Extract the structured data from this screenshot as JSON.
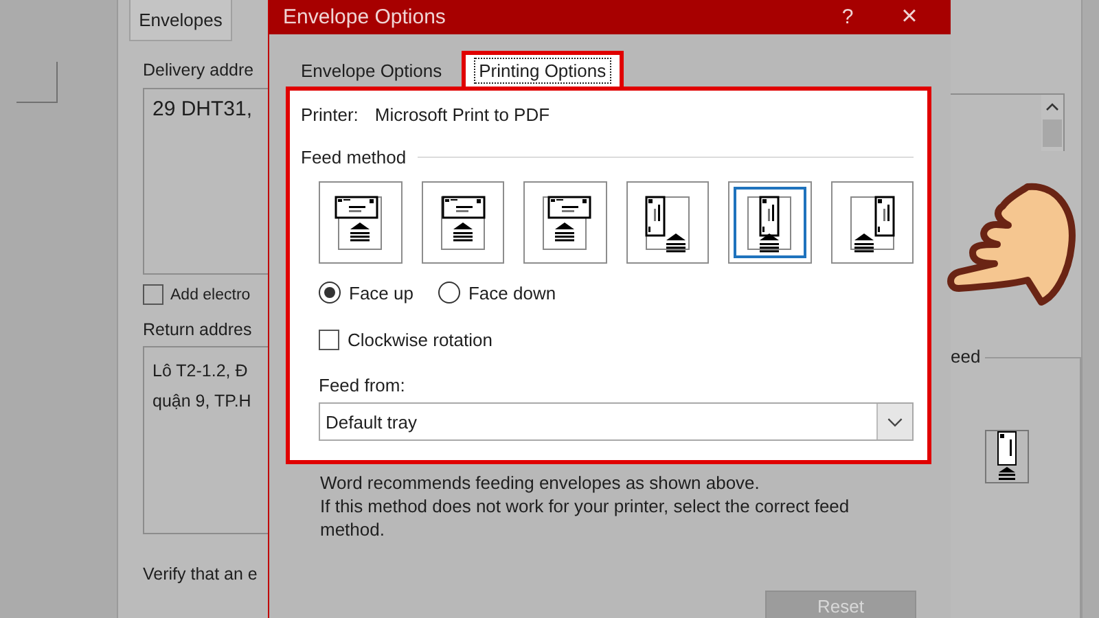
{
  "background_dialog": {
    "tabs": [
      {
        "label": "Envelopes",
        "selected": true
      }
    ],
    "delivery_address": {
      "label": "Delivery addre",
      "value": "29 DHT31,"
    },
    "add_electronic_postage": {
      "label": "Add electro",
      "checked": false
    },
    "return_address": {
      "label": "Return addres",
      "lines": [
        "Lô T2-1.2, Đ",
        "quận 9, TP.H"
      ]
    },
    "footer_text": "Verify that an e",
    "feed_label": "eed"
  },
  "dialog": {
    "title": "Envelope Options",
    "help": "?",
    "close": "×",
    "tabs": [
      {
        "label": "Envelope Options",
        "selected": false
      },
      {
        "label": "Printing Options",
        "selected": true
      }
    ],
    "printer": {
      "label": "Printer:",
      "value": "Microsoft Print to PDF"
    },
    "feed_method": {
      "heading": "Feed method",
      "options": [
        {
          "kind": "landscape_left",
          "selected": false
        },
        {
          "kind": "landscape_center",
          "selected": false
        },
        {
          "kind": "landscape_right",
          "selected": false
        },
        {
          "kind": "portrait_left",
          "selected": false
        },
        {
          "kind": "portrait_center",
          "selected": true
        },
        {
          "kind": "portrait_right",
          "selected": false
        }
      ]
    },
    "face": [
      {
        "label": "Face up",
        "selected": true
      },
      {
        "label": "Face down",
        "selected": false
      }
    ],
    "clockwise_rotation": {
      "label": "Clockwise rotation",
      "checked": false
    },
    "feed_from": {
      "label": "Feed from:",
      "value": "Default tray"
    },
    "note": [
      "Word recommends feeding envelopes as shown above.",
      "If this method does not work for your printer, select the correct feed",
      "method."
    ],
    "reset_button": {
      "label": "Reset",
      "disabled": true
    }
  }
}
